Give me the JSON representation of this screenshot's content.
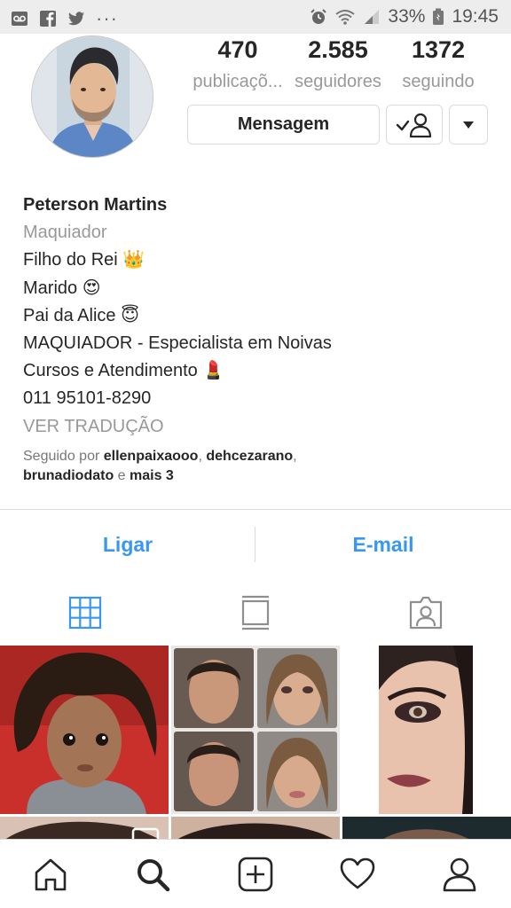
{
  "status_bar": {
    "dots": "···",
    "battery_percent": "33%",
    "time": "19:45"
  },
  "profile": {
    "stats": [
      {
        "value": "470",
        "label": "publicaçõ..."
      },
      {
        "value": "2.585",
        "label": "seguidores"
      },
      {
        "value": "1372",
        "label": "seguindo"
      }
    ],
    "message_button": "Mensagem",
    "following_icon": "person-check-icon",
    "more_icon": "caret-down-icon"
  },
  "bio": {
    "name": "Peterson Martins",
    "category": "Maquiador",
    "lines": [
      "Filho do Rei 👑",
      "Marido 😍",
      "Pai da Alice 😇",
      "MAQUIADOR - Especialista em Noivas",
      "Cursos e Atendimento 💄",
      "011 95101-8290"
    ],
    "translate": "VER TRADUÇÃO",
    "followed_by": {
      "prefix": "Seguido por ",
      "user1": "ellenpaixaooo",
      "comma": ", ",
      "user2": "dehcezarano",
      "comma2": ",",
      "user3": "brunadiodato",
      "conj": " e ",
      "more": "mais 3"
    }
  },
  "contact": {
    "call": "Ligar",
    "email": "E-mail"
  },
  "tabs": [
    "grid-icon",
    "feed-icon",
    "tagged-icon"
  ],
  "bottom_nav": [
    "home-icon",
    "search-icon",
    "add-icon",
    "heart-icon",
    "profile-icon"
  ],
  "colors": {
    "accent": "#3897f0",
    "muted": "#999999",
    "status_bar": "#ededed"
  }
}
